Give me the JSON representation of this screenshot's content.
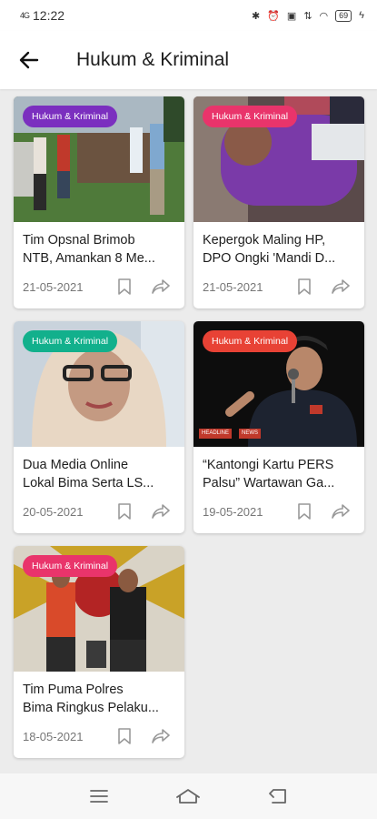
{
  "status_bar": {
    "time": "12:22",
    "signal": "4G",
    "battery": "69"
  },
  "header": {
    "title": "Hukum & Kriminal"
  },
  "articles": [
    {
      "category": "Hukum & Kriminal",
      "badge_color": "#7b2fbf",
      "title_line1": "Tim Opsnal Brimob",
      "title_line2": "NTB, Amankan 8 Me...",
      "date": "21-05-2021"
    },
    {
      "category": "Hukum & Kriminal",
      "badge_color": "#e9346b",
      "title_line1": "Kepergok Maling HP,",
      "title_line2": "DPO Ongki  'Mandi D...",
      "date": "21-05-2021"
    },
    {
      "category": "Hukum & Kriminal",
      "badge_color": "#12b08c",
      "title_line1": "Dua Media Online",
      "title_line2": "Lokal Bima Serta LS...",
      "date": "20-05-2021"
    },
    {
      "category": "Hukum & Kriminal",
      "badge_color": "#e84235",
      "title_line1": "“Kantongi Kartu PERS",
      "title_line2": "Palsu” Wartawan Ga...",
      "date": "19-05-2021"
    },
    {
      "category": "Hukum & Kriminal",
      "badge_color": "#e9346b",
      "title_line1": "Tim Puma Polres",
      "title_line2": "Bima Ringkus Pelaku...",
      "date": "18-05-2021"
    }
  ],
  "image4_tags": [
    "HEADLINE",
    "NEWS"
  ]
}
